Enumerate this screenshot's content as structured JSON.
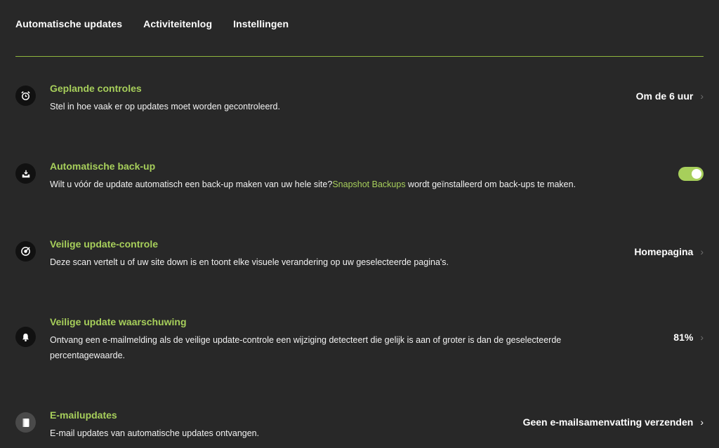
{
  "tabs": [
    {
      "label": "Automatische updates"
    },
    {
      "label": "Activiteitenlog"
    },
    {
      "label": "Instellingen"
    }
  ],
  "colors": {
    "accent": "#a7cf5b",
    "background": "#282828",
    "divider": "#8fb53e"
  },
  "rows": [
    {
      "icon": "alarm-clock-icon",
      "title": "Geplande controles",
      "desc": "Stel in hoe vaak er op updates moet worden gecontroleerd.",
      "value": "Om de 6 uur"
    },
    {
      "icon": "backup-download-icon",
      "title": "Automatische back-up",
      "desc_before": "Wilt u vóór de update automatisch een back-up maken van uw hele site?",
      "desc_link": "Snapshot Backups",
      "desc_after": " wordt geïnstalleerd om back-ups te maken.",
      "toggle_on": true
    },
    {
      "icon": "target-scan-icon",
      "title": "Veilige update-controle",
      "desc": "Deze scan vertelt u of uw site down is en toont elke visuele verandering op uw geselecteerde pagina's.",
      "value": "Homepagina"
    },
    {
      "icon": "bell-icon",
      "title": "Veilige update waarschuwing",
      "desc_line1": "Ontvang een e-mailmelding als de veilige update-controle een wijziging detecteert die gelijk is aan of groter is dan de geselecteerde",
      "desc_line2": "percentagewaarde.",
      "value": "81%"
    },
    {
      "icon": "document-icon",
      "title": "E-mailupdates",
      "desc": "E-mail updates van automatische updates ontvangen.",
      "value": "Geen e-mailsamenvatting verzenden"
    }
  ],
  "chevron": "›"
}
